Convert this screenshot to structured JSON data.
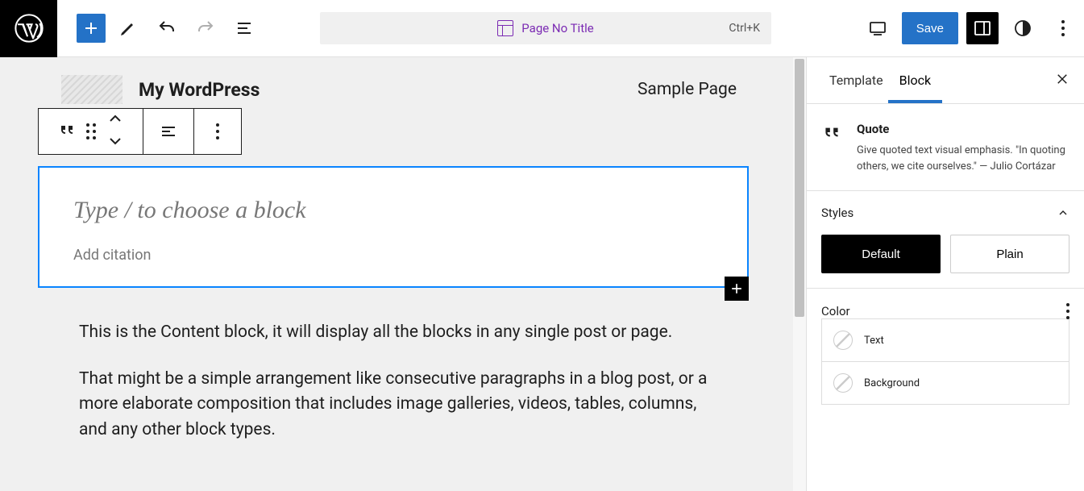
{
  "topbar": {
    "save_label": "Save"
  },
  "docbar": {
    "label": "Page No Title",
    "shortcut": "Ctrl+K"
  },
  "site": {
    "title": "My WordPress",
    "nav_item": "Sample Page"
  },
  "editor": {
    "quote_placeholder": "Type / to choose a block",
    "citation_placeholder": "Add citation",
    "content_p1": "This is the Content block, it will display all the blocks in any single post or page.",
    "content_p2": "That might be a simple arrangement like consecutive paragraphs in a blog post, or a more elaborate composition that includes image galleries, videos, tables, columns, and any other block types."
  },
  "sidebar": {
    "tabs": {
      "template": "Template",
      "block": "Block"
    },
    "block": {
      "name": "Quote",
      "desc": "Give quoted text visual emphasis. \"In quoting others, we cite ourselves.\" — Julio Cortázar"
    },
    "styles": {
      "heading": "Styles",
      "default": "Default",
      "plain": "Plain"
    },
    "color": {
      "heading": "Color",
      "text": "Text",
      "background": "Background"
    }
  }
}
